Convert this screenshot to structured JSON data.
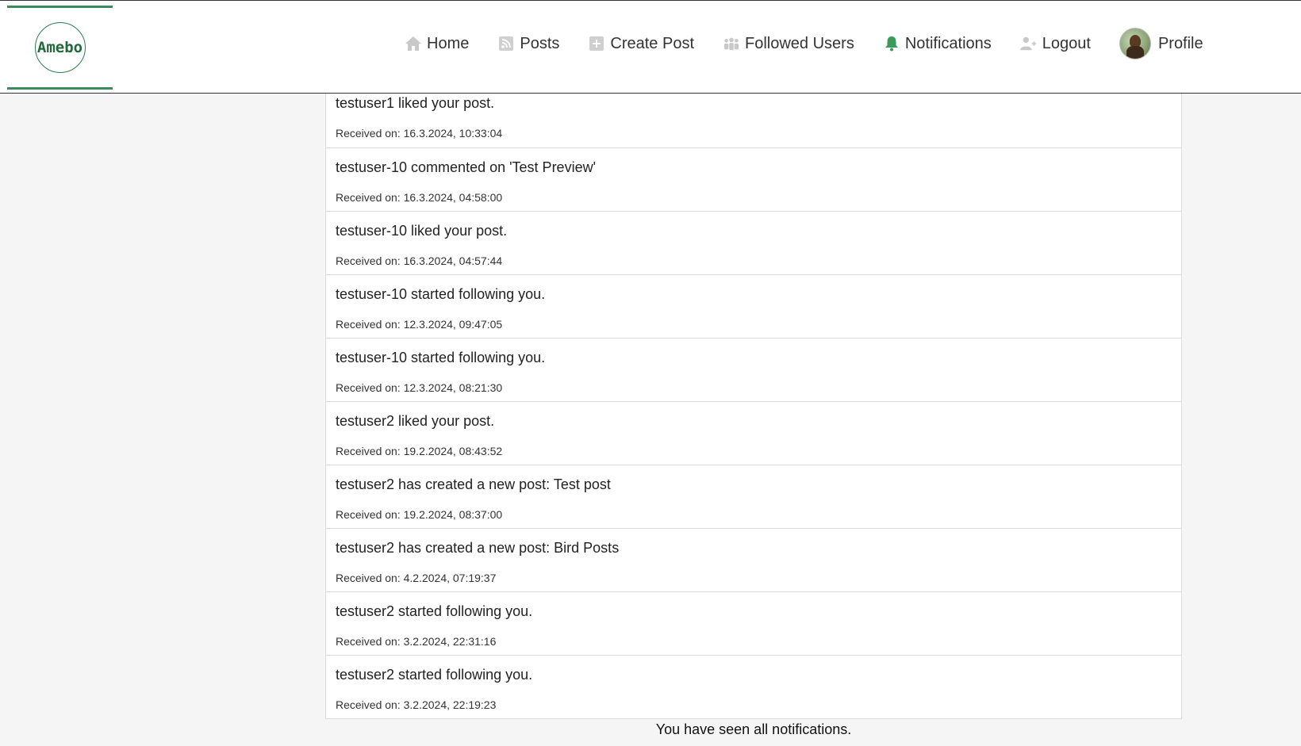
{
  "app": {
    "logo_text": "Amebo",
    "accent_color": "#3a8a5a"
  },
  "nav": {
    "items": [
      {
        "label": "Home",
        "icon": "home-icon"
      },
      {
        "label": "Posts",
        "icon": "rss-icon"
      },
      {
        "label": "Create Post",
        "icon": "plus-square-icon"
      },
      {
        "label": "Followed Users",
        "icon": "users-icon"
      },
      {
        "label": "Notifications",
        "icon": "bell-icon"
      },
      {
        "label": "Logout",
        "icon": "user-plus-icon"
      }
    ],
    "profile_label": "Profile"
  },
  "notifications": [
    {
      "message": "testuser1 liked your post.",
      "time": "Received on: 16.3.2024, 10:33:04"
    },
    {
      "message": "testuser-10 commented on 'Test Preview'",
      "time": "Received on: 16.3.2024, 04:58:00"
    },
    {
      "message": "testuser-10 liked your post.",
      "time": "Received on: 16.3.2024, 04:57:44"
    },
    {
      "message": "testuser-10 started following you.",
      "time": "Received on: 12.3.2024, 09:47:05"
    },
    {
      "message": "testuser-10 started following you.",
      "time": "Received on: 12.3.2024, 08:21:30"
    },
    {
      "message": "testuser2 liked your post.",
      "time": "Received on: 19.2.2024, 08:43:52"
    },
    {
      "message": "testuser2 has created a new post: Test post",
      "time": "Received on: 19.2.2024, 08:37:00"
    },
    {
      "message": "testuser2 has created a new post: Bird Posts",
      "time": "Received on: 4.2.2024, 07:19:37"
    },
    {
      "message": "testuser2 started following you.",
      "time": "Received on: 3.2.2024, 22:31:16"
    },
    {
      "message": "testuser2 started following you.",
      "time": "Received on: 3.2.2024, 22:19:23"
    }
  ],
  "end_message": "You have seen all notifications."
}
